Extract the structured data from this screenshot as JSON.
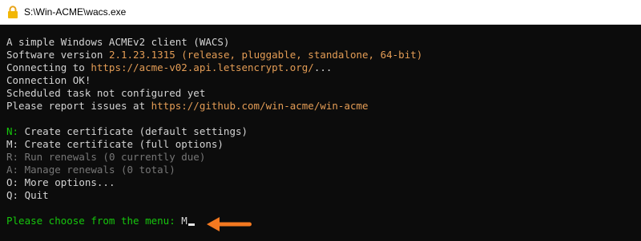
{
  "window": {
    "title": "S:\\Win-ACME\\wacs.exe",
    "icon": "lock-icon"
  },
  "console": {
    "header": {
      "line1": "A simple Windows ACMEv2 client (WACS)",
      "version_prefix": "Software version ",
      "version": "2.1.23.1315",
      "version_details": " (release, pluggable, standalone, 64-bit)",
      "connecting_prefix": "Connecting to ",
      "connecting_url": "https://acme-v02.api.letsencrypt.org/",
      "connecting_suffix": "...",
      "connection_ok": "Connection OK!",
      "scheduled": "Scheduled task not configured yet",
      "report_prefix": "Please report issues at ",
      "report_url": "https://github.com/win-acme/win-acme"
    },
    "menu": [
      {
        "key": "N:",
        "label": " Create certificate (default settings)",
        "state": "default"
      },
      {
        "key": "M:",
        "label": " Create certificate (full options)",
        "state": "normal"
      },
      {
        "key": "R:",
        "label": " Run renewals (0 currently due)",
        "state": "disabled"
      },
      {
        "key": "A:",
        "label": " Manage renewals (0 total)",
        "state": "disabled"
      },
      {
        "key": "O:",
        "label": " More options...",
        "state": "normal"
      },
      {
        "key": "Q:",
        "label": " Quit",
        "state": "normal"
      }
    ],
    "prompt": {
      "text": "Please choose from the menu: ",
      "input": "M"
    }
  },
  "colors": {
    "background": "#0c0c0c",
    "text": "#d4d4d4",
    "highlight_orange": "#e39c55",
    "highlight_green": "#16c60c",
    "disabled": "#767676",
    "annotation_arrow": "#f47920"
  },
  "annotation": {
    "icon": "arrow-left-icon"
  }
}
